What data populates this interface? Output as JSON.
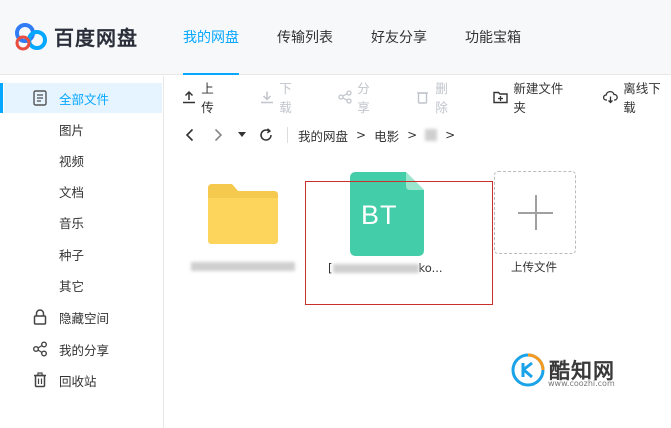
{
  "app": {
    "name": "百度网盘",
    "accent": "#06a7ff"
  },
  "nav": {
    "tabs": [
      {
        "label": "我的网盘",
        "active": true
      },
      {
        "label": "传输列表",
        "active": false
      },
      {
        "label": "好友分享",
        "active": false
      },
      {
        "label": "功能宝箱",
        "active": false
      }
    ]
  },
  "sidebar": {
    "items": [
      {
        "label": "全部文件",
        "icon": "document-icon",
        "active": true
      },
      {
        "label": "图片"
      },
      {
        "label": "视频"
      },
      {
        "label": "文档"
      },
      {
        "label": "音乐"
      },
      {
        "label": "种子"
      },
      {
        "label": "其它"
      },
      {
        "label": "隐藏空间",
        "icon": "lock-icon"
      },
      {
        "label": "我的分享",
        "icon": "share-icon"
      },
      {
        "label": "回收站",
        "icon": "trash-icon"
      }
    ]
  },
  "toolbar": {
    "upload": "上传",
    "download": "下载",
    "share": "分享",
    "delete": "删除",
    "new_folder": "新建文件夹",
    "offline_download": "离线下载"
  },
  "breadcrumb": {
    "items": [
      "我的网盘",
      "电影"
    ]
  },
  "files": {
    "torrent_badge": "BT",
    "torrent_name": "[",
    "torrent_suffix": "ko...",
    "upload_label": "上传文件"
  },
  "watermark": {
    "name": "酷知网",
    "url": "www.coozhi.com",
    "colors": {
      "orange": "#f39a1f",
      "blue": "#1aa3e8"
    }
  }
}
